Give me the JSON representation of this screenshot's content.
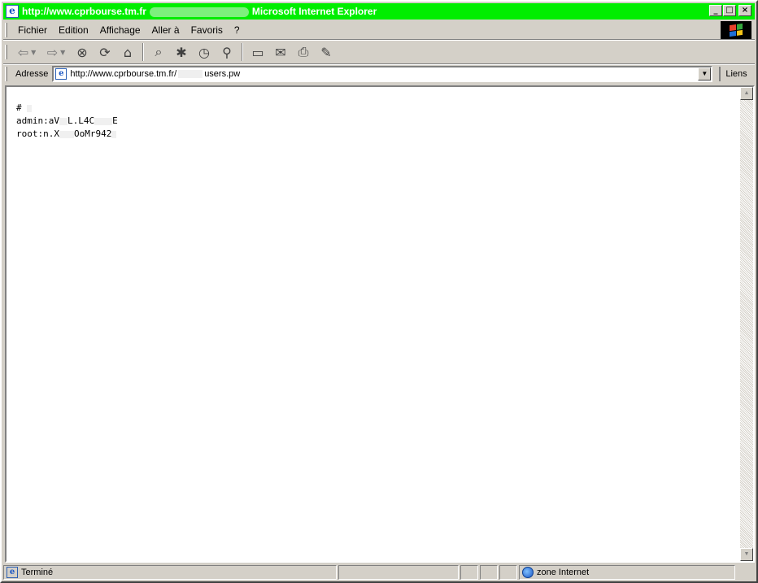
{
  "title": {
    "url_prefix": "http://www.cprbourse.tm.fr",
    "app_name": "Microsoft Internet Explorer",
    "minimize": "_",
    "maximize": "□",
    "close": "×"
  },
  "menu": [
    "Fichier",
    "Edition",
    "Affichage",
    "Aller à",
    "Favoris",
    "?"
  ],
  "toolbar": {
    "icons": [
      "back-icon",
      "forward-icon",
      "stop-icon",
      "refresh-icon",
      "home-icon",
      "search-icon",
      "favorites-icon",
      "history-icon",
      "channels-icon",
      "fullscreen-icon",
      "mail-icon",
      "print-icon",
      "edit-icon"
    ]
  },
  "address": {
    "label": "Adresse",
    "url_start": "http://www.cprbourse.tm.fr/",
    "url_end": "users.pw",
    "links_label": "Liens"
  },
  "content": {
    "line1": "# ",
    "line2_start": "admin:aV",
    "line2_mid": "L.L4C",
    "line2_end": "E",
    "line3_start": "root:n.X",
    "line3_end": "OoMr942"
  },
  "status": {
    "text": "Terminé",
    "zone": "zone Internet"
  }
}
